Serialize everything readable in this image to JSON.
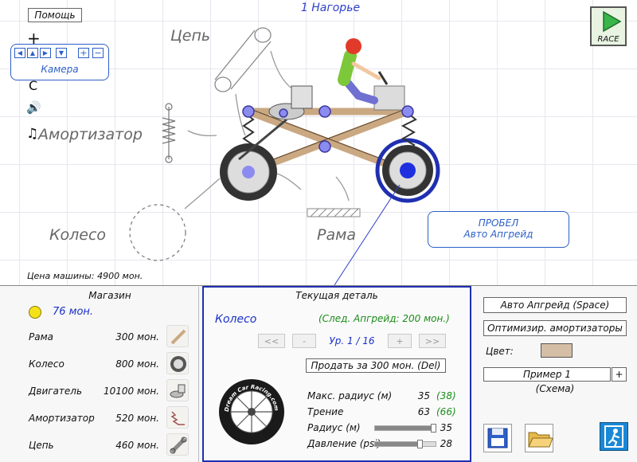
{
  "level_title": "1 Нагорье",
  "help_label": "Помощь",
  "race": {
    "label": "RACE",
    "icon": "play-icon"
  },
  "zoom": {
    "in": "+",
    "out": "−"
  },
  "camera": {
    "label": "Камера"
  },
  "tool_glyphs": {
    "reset": "C",
    "sound": "🔊",
    "music": "♫"
  },
  "diagram_labels": {
    "chain": "Цепь",
    "shock": "Амортизатор",
    "wheel": "Колесо",
    "frame": "Рама"
  },
  "space_hint": {
    "line1": "ПРОБЕЛ",
    "line2": "Авто Апгрейд"
  },
  "car_price": "Цена машины: 4900 мон.",
  "shop": {
    "title": "Магазин",
    "money": "76 мон.",
    "items": [
      {
        "name": "Рама",
        "price": "300 мон.",
        "icon": "frame-part-icon"
      },
      {
        "name": "Колесо",
        "price": "800 мон.",
        "icon": "wheel-part-icon"
      },
      {
        "name": "Двигатель",
        "price": "10100 мон.",
        "icon": "engine-part-icon"
      },
      {
        "name": "Амортизатор",
        "price": "520 мон.",
        "icon": "shock-part-icon"
      },
      {
        "name": "Цепь",
        "price": "460 мон.",
        "icon": "chain-part-icon"
      }
    ]
  },
  "current_part": {
    "title": "Текущая деталь",
    "name": "Колесо",
    "next_upgrade": "(След. Апгрейд:  200 мон.)",
    "first": "<<",
    "minus": "-",
    "level": "Ур. 1 / 16",
    "plus": "+",
    "last": ">>",
    "sell": "Продать за  300 мон. (Del)",
    "tire_text": "Dream Car Racing.com",
    "stats": [
      {
        "label": "Макс. радиус (м)",
        "value": "35",
        "next": "(38)"
      },
      {
        "label": "Трение",
        "value": "63",
        "next": "(66)"
      }
    ],
    "sliders": [
      {
        "label": "Радиус (м)",
        "value": "35",
        "fraction": 0.98
      },
      {
        "label": "Давление (psi)",
        "value": "28",
        "fraction": 0.75
      }
    ]
  },
  "right": {
    "auto_upgrade": "Авто Апгрейд (Space)",
    "optimize": "Оптимизир. амортизаторы",
    "color_label": "Цвет:",
    "color_value": "#d4bfa6",
    "scheme_name": "Пример 1",
    "scheme_add": "+",
    "scheme_caption": "(Схема)"
  },
  "colors": {
    "accent": "#2d5fc8",
    "money_coin": "#f3e21a",
    "green": "#1a8c1a"
  }
}
